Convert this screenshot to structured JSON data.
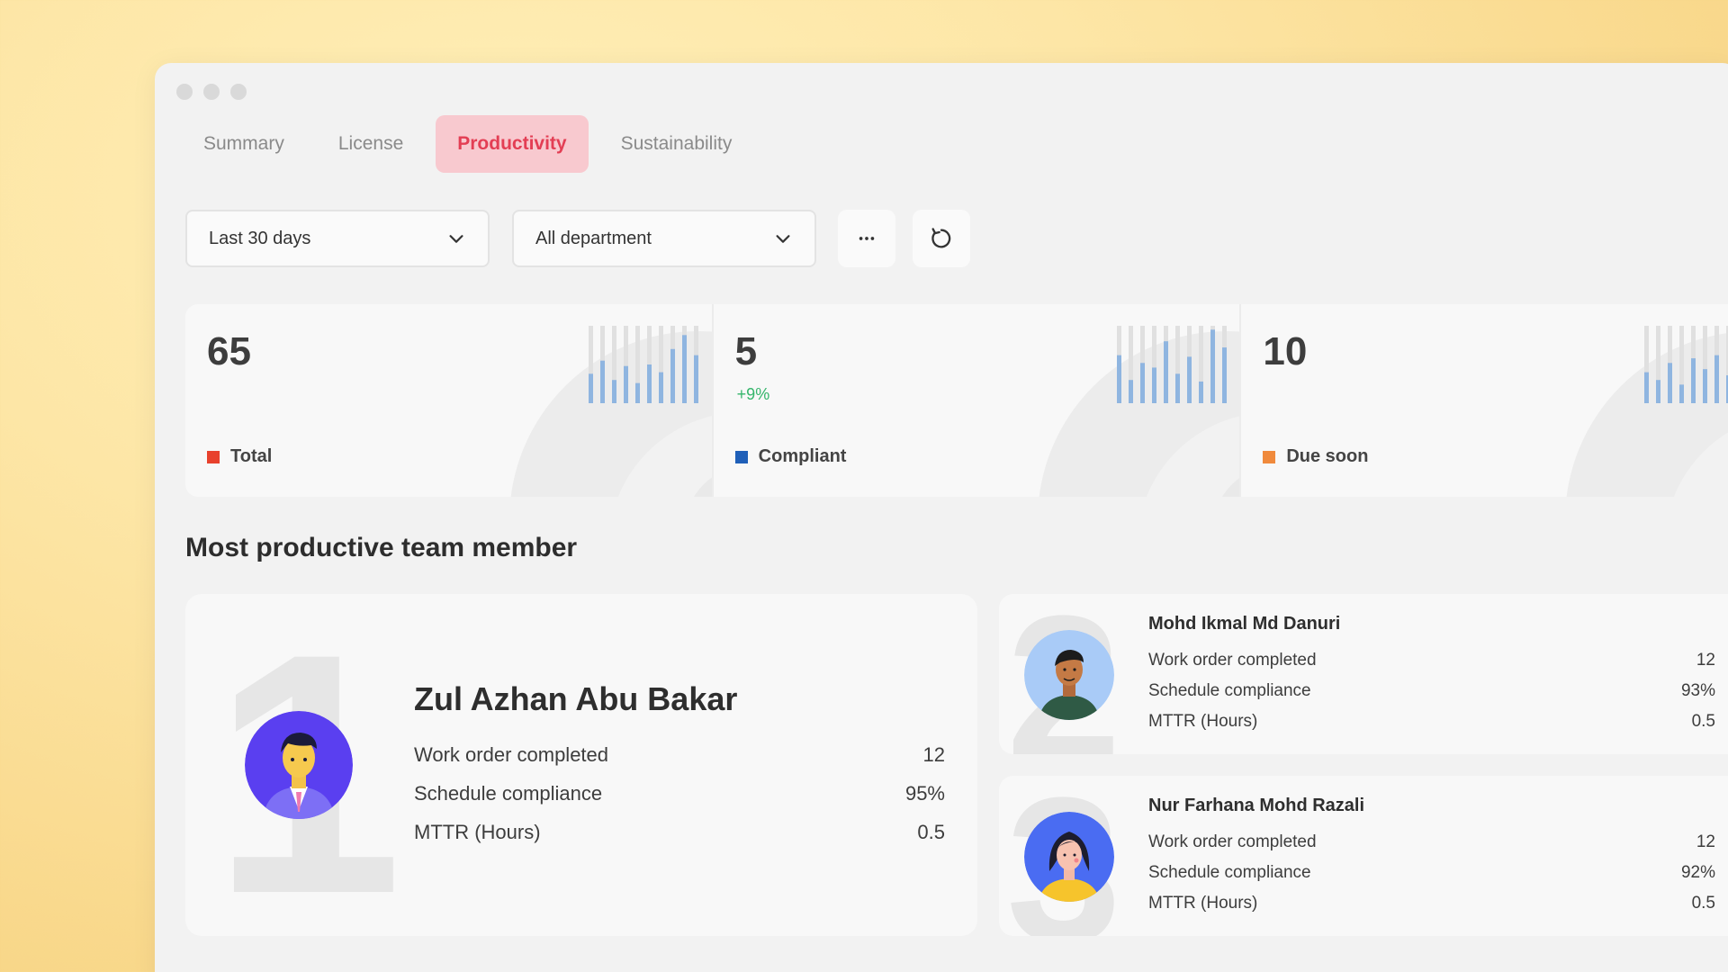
{
  "tabs": [
    {
      "label": "Summary",
      "active": false
    },
    {
      "label": "License",
      "active": false
    },
    {
      "label": "Productivity",
      "active": true
    },
    {
      "label": "Sustainability",
      "active": false
    }
  ],
  "filters": {
    "period": "Last 30 days",
    "department": "All department"
  },
  "icons": {
    "more": "more-horizontal-icon",
    "refresh": "refresh-icon",
    "chevron": "chevron-down-icon"
  },
  "stats": [
    {
      "value": "65",
      "delta": "",
      "label": "Total",
      "color": "#e8412c"
    },
    {
      "value": "5",
      "delta": "+9%",
      "label": "Compliant",
      "color": "#1f5fb8"
    },
    {
      "value": "10",
      "delta": "",
      "label": "Due soon",
      "color": "#f08a3c"
    }
  ],
  "section_title": "Most productive team member",
  "metric_labels": {
    "work_orders": "Work order completed",
    "schedule": "Schedule compliance",
    "mttr": "MTTR (Hours)"
  },
  "members": [
    {
      "rank": "1",
      "name": "Zul Azhan Abu Bakar",
      "work_orders": "12",
      "schedule": "95%",
      "mttr": "0.5"
    },
    {
      "rank": "2",
      "name": "Mohd Ikmal Md Danuri",
      "work_orders": "12",
      "schedule": "93%",
      "mttr": "0.5"
    },
    {
      "rank": "3",
      "name": "Nur Farhana Mohd Razali",
      "work_orders": "12",
      "schedule": "92%",
      "mttr": "0.5"
    }
  ],
  "colors": {
    "accent_tab_bg": "#f8c9cf",
    "accent_tab_text": "#e33e54",
    "positive": "#34b56a",
    "spark_bar": "#8fb5e0",
    "spark_track": "#e0e0e0"
  }
}
